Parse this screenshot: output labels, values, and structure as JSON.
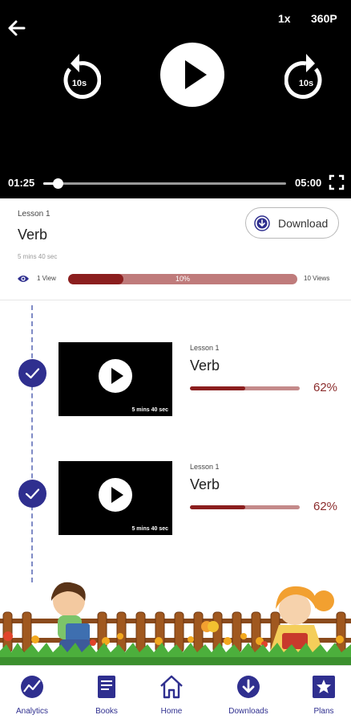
{
  "player": {
    "speed": "1x",
    "quality": "360P",
    "current_time": "01:25",
    "total_time": "05:00",
    "progress_fraction": 0.06,
    "rewind_label": "10s",
    "forward_label": "10s"
  },
  "current_lesson": {
    "label": "Lesson 1",
    "title": "Verb",
    "duration": "5 mins 40 sec",
    "download_label": "Download",
    "views_min": "1 View",
    "views_max": "10 Views",
    "views_percent_text": "10%",
    "views_fraction": 0.24
  },
  "lessons": [
    {
      "label": "Lesson 1",
      "title": "Verb",
      "duration": "5 mins 40 sec",
      "percent_text": "62%",
      "progress_fraction": 0.5,
      "completed": true
    },
    {
      "label": "Lesson 1",
      "title": "Verb",
      "duration": "5 mins 40 sec",
      "percent_text": "62%",
      "progress_fraction": 0.5,
      "completed": true
    }
  ],
  "bottom_nav": {
    "items": [
      {
        "label": "Analytics",
        "icon": "analytics-icon"
      },
      {
        "label": "Books",
        "icon": "book-icon"
      },
      {
        "label": "Home",
        "icon": "home-icon"
      },
      {
        "label": "Downloads",
        "icon": "download-icon"
      },
      {
        "label": "Plans",
        "icon": "star-icon"
      }
    ]
  },
  "colors": {
    "primary": "#2f2f8f",
    "progress": "#8b1e1e",
    "progress_track": "#bf7b7b",
    "player_bg": "#000000"
  }
}
